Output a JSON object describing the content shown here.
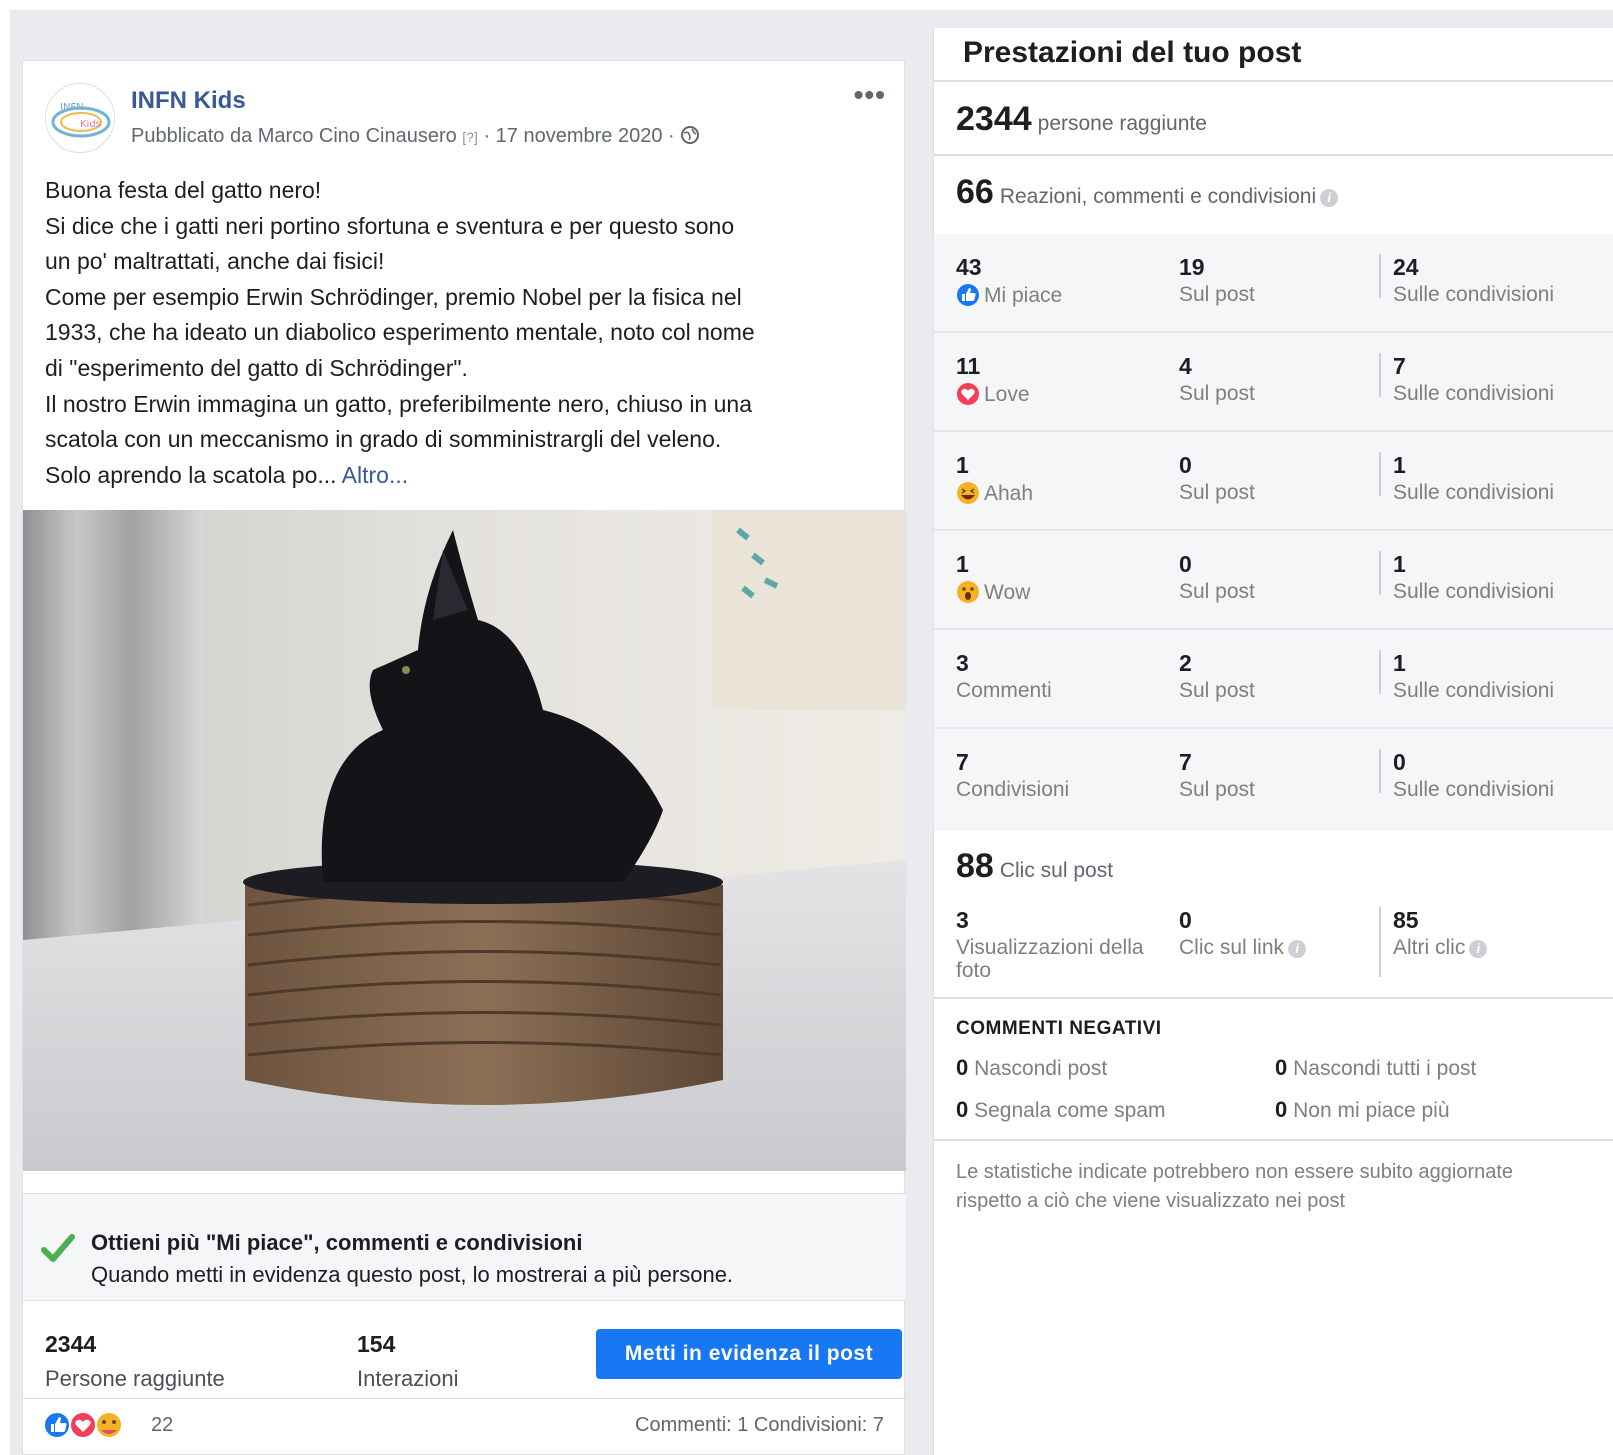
{
  "post": {
    "page_name": "INFN Kids",
    "meta_prefix": "Pubblicato da Marco Cino Cinausero",
    "meta_help": "[?]",
    "meta_date": "· 17 novembre 2020 ·",
    "avatar_text": "INFN Kids",
    "more_label": "•••",
    "text_lines": [
      "Buona festa del gatto nero!",
      "Si dice che i gatti neri portino sfortuna e sventura e per questo sono",
      "un po' maltrattati, anche dai fisici!",
      "Come per esempio Erwin Schrödinger, premio Nobel per la fisica nel",
      "1933, che ha ideato un diabolico esperimento mentale, noto col nome",
      "di \"esperimento del gatto di Schrödinger\".",
      "Il nostro Erwin immagina un gatto, preferibilmente nero, chiuso in una",
      "scatola con un meccanismo in grado di somministrargli del veleno.",
      "Solo aprendo la scatola po..."
    ],
    "more_link": "Altro...",
    "promo_title": "Ottieni più \"Mi piace\", commenti e condivisioni",
    "promo_sub": "Quando metti in evidenza questo post, lo mostrerai a più persone.",
    "reach_value": "2344",
    "reach_label": "Persone raggiunte",
    "interactions_value": "154",
    "interactions_label": "Interazioni",
    "boost_label": "Metti in evidenza il post",
    "reactions_count": "22",
    "comments_shares": "Commenti: 1  Condivisioni: 7"
  },
  "panel": {
    "title": "Prestazioni del tuo post",
    "reached_value": "2344",
    "reached_label": "persone raggiunte",
    "engagement_value": "66",
    "engagement_label": "Reazioni, commenti e condivisioni",
    "rows": [
      {
        "icon": "like-icon",
        "v1": "43",
        "l1": "Mi piace",
        "v2": "19",
        "l2": "Sul post",
        "v3": "24",
        "l3": "Sulle condivisioni"
      },
      {
        "icon": "love-icon",
        "v1": "11",
        "l1": "Love",
        "v2": "4",
        "l2": "Sul post",
        "v3": "7",
        "l3": "Sulle condivisioni"
      },
      {
        "icon": "haha-icon",
        "v1": "1",
        "l1": "Ahah",
        "v2": "0",
        "l2": "Sul post",
        "v3": "1",
        "l3": "Sulle condivisioni"
      },
      {
        "icon": "wow-icon",
        "v1": "1",
        "l1": "Wow",
        "v2": "0",
        "l2": "Sul post",
        "v3": "1",
        "l3": "Sulle condivisioni"
      },
      {
        "icon": "",
        "v1": "3",
        "l1": "Commenti",
        "v2": "2",
        "l2": "Sul post",
        "v3": "1",
        "l3": "Sulle condivisioni"
      },
      {
        "icon": "",
        "v1": "7",
        "l1": "Condivisioni",
        "v2": "7",
        "l2": "Sul post",
        "v3": "0",
        "l3": "Sulle condivisioni"
      }
    ],
    "clicks_value": "88",
    "clicks_label": "Clic sul post",
    "photo_views_value": "3",
    "photo_views_label_1": "Visualizzazioni della",
    "photo_views_label_2": "foto",
    "link_clicks_value": "0",
    "link_clicks_label": "Clic sul link",
    "other_clicks_value": "85",
    "other_clicks_label": "Altri clic",
    "negative_title": "COMMENTI NEGATIVI",
    "hide_post_value": "0",
    "hide_post_label": "Nascondi post",
    "hide_all_value": "0",
    "hide_all_label": "Nascondi tutti i post",
    "spam_value": "0",
    "spam_label": "Segnala come spam",
    "unlike_value": "0",
    "unlike_label": "Non mi piace più",
    "footnote": "Le statistiche indicate potrebbero non essere subito aggiornate rispetto a ciò che viene visualizzato nei post"
  },
  "colors": {
    "accent": "#1877f2",
    "link": "#385898",
    "page_bg": "#e9ebee"
  }
}
